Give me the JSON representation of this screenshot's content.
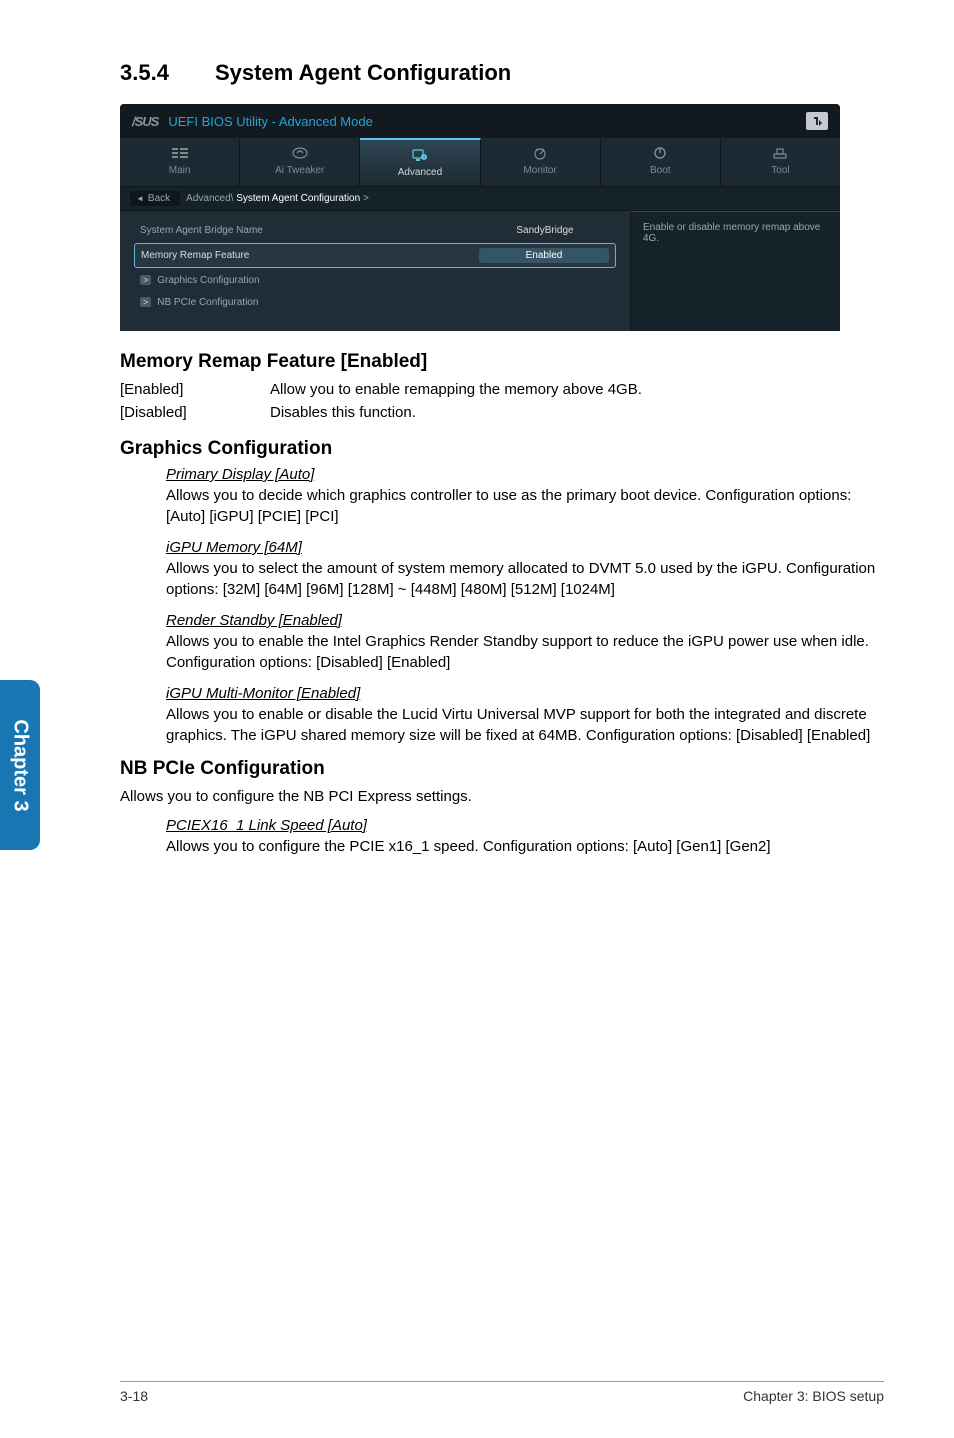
{
  "chapter_tab": "Chapter 3",
  "section": {
    "number": "3.5.4",
    "title": "System Agent Configuration"
  },
  "bios": {
    "brand": "/SUS",
    "utility_title": "UEFI BIOS Utility - Advanced Mode",
    "tabs": [
      {
        "label": "Main",
        "active": false
      },
      {
        "label": "Ai Tweaker",
        "active": false
      },
      {
        "label": "Advanced",
        "active": true
      },
      {
        "label": "Monitor",
        "active": false
      },
      {
        "label": "Boot",
        "active": false
      },
      {
        "label": "Tool",
        "active": false
      }
    ],
    "back_label": "Back",
    "breadcrumb_path_prefix": "Advanced\\ ",
    "breadcrumb_current": "System Agent Configuration",
    "breadcrumb_path_suffix": " >",
    "rows": [
      {
        "label": "System Agent Bridge Name",
        "value": "SandyBridge",
        "type": "info"
      },
      {
        "label": "Memory Remap Feature",
        "value": "Enabled",
        "type": "selected"
      },
      {
        "label": "Graphics Configuration",
        "value": "",
        "type": "sub"
      },
      {
        "label": "NB PCIe Configuration",
        "value": "",
        "type": "sub"
      }
    ],
    "help_text": "Enable or disable memory remap above 4G."
  },
  "headings": {
    "memory_remap": "Memory Remap Feature [Enabled]",
    "graphics_config": "Graphics Configuration",
    "nb_pcie": "NB PCIe Configuration"
  },
  "memory_remap_options": [
    {
      "key": "[Enabled]",
      "val": "Allow you to enable remapping the memory above 4GB."
    },
    {
      "key": "[Disabled]",
      "val": "Disables this function."
    }
  ],
  "graphics_settings": [
    {
      "name": "Primary Display [Auto]",
      "desc": "Allows you to decide which graphics controller to use as the primary boot device. Configuration options: [Auto] [iGPU] [PCIE] [PCI]"
    },
    {
      "name": "iGPU Memory [64M]",
      "desc": "Allows you to select the amount of system memory allocated to DVMT 5.0 used by the iGPU. Configuration options: [32M] [64M] [96M] [128M] ~ [448M] [480M] [512M] [1024M]"
    },
    {
      "name": "Render Standby [Enabled]",
      "desc": "Allows you to enable the Intel Graphics Render Standby support to reduce the iGPU power use when idle. Configuration options: [Disabled] [Enabled]"
    },
    {
      "name": "iGPU Multi-Monitor [Enabled]",
      "desc": "Allows you to enable or disable the Lucid Virtu Universal MVP support for both the integrated and discrete graphics. The iGPU shared memory size will be fixed at 64MB. Configuration options: [Disabled] [Enabled]"
    }
  ],
  "nb_pcie_intro": "Allows you to configure the NB PCI Express settings.",
  "nb_pcie_settings": [
    {
      "name": "PCIEX16_1 Link Speed [Auto]",
      "desc": "Allows you to configure the PCIE x16_1 speed. Configuration options: [Auto] [Gen1] [Gen2]"
    }
  ],
  "footer": {
    "left": "3-18",
    "right": "Chapter 3: BIOS setup"
  }
}
